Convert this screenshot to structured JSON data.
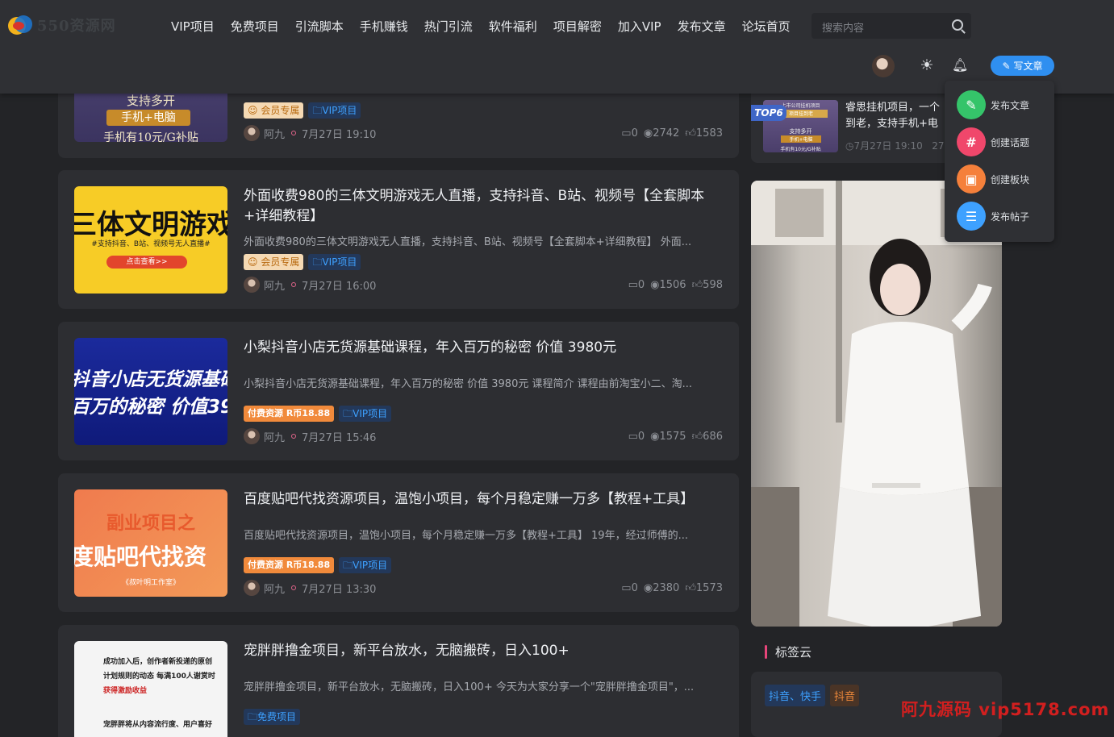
{
  "header": {
    "logo_text": "550资源网",
    "nav": [
      "VIP项目",
      "免费项目",
      "引流脚本",
      "手机赚钱",
      "热门引流",
      "软件福利",
      "项目解密",
      "加入VIP",
      "发布文章",
      "论坛首页"
    ],
    "search_placeholder": "搜索内容",
    "write_button": "写文章"
  },
  "dropdown": {
    "items": [
      {
        "label": "发布文章",
        "icon": "edit-icon",
        "color": "#35c46a"
      },
      {
        "label": "创建话题",
        "icon": "hash-icon",
        "color": "#f0476b"
      },
      {
        "label": "创建板块",
        "icon": "cube-icon",
        "color": "#f5803b"
      },
      {
        "label": "发布帖子",
        "icon": "chat-icon",
        "color": "#3ea1ff"
      }
    ]
  },
  "posts": [
    {
      "title": "",
      "excerpt": "",
      "thumb_lines": [
        "支持多开",
        "手机+电脑",
        "手机有10元/G补贴"
      ],
      "tags": [
        "会员专属",
        "VIP项目"
      ],
      "author": "阿九",
      "time": "7月27日 19:10",
      "comments": "0",
      "views": "2742",
      "likes": "1583"
    },
    {
      "title": "外面收费980的三体文明游戏无人直播，支持抖音、B站、视频号【全套脚本+详细教程】",
      "excerpt": "外面收费980的三体文明游戏无人直播，支持抖音、B站、视频号【全套脚本+详细教程】 外面...",
      "thumb_lines": [
        "三体文明游戏",
        "#支持抖音、B站、视频号无人直播#",
        "点击查看>>"
      ],
      "tags": [
        "会员专属",
        "VIP项目"
      ],
      "author": "阿九",
      "time": "7月27日 16:00",
      "comments": "0",
      "views": "1506",
      "likes": "598"
    },
    {
      "title": "小梨抖音小店无货源基础课程，年入百万的秘密 价值 3980元",
      "excerpt": "小梨抖音小店无货源基础课程，年入百万的秘密 价值 3980元 课程简介 课程由前淘宝小二、淘...",
      "thumb_lines": [
        "抖音小店无货源基础",
        "百万的秘密 价值398"
      ],
      "tags": [
        "付费资源 R币18.88",
        "VIP项目"
      ],
      "author": "阿九",
      "time": "7月27日 15:46",
      "comments": "0",
      "views": "1575",
      "likes": "686"
    },
    {
      "title": "百度贴吧代找资源项目，温饱小项目，每个月稳定赚一万多【教程+工具】",
      "excerpt": "百度贴吧代找资源项目，温饱小项目，每个月稳定赚一万多【教程+工具】 19年，经过师傅的...",
      "thumb_lines": [
        "副业项目之",
        "度贴吧代找资",
        "《叔叶明工作室》"
      ],
      "tags": [
        "付费资源 R币18.88",
        "VIP项目"
      ],
      "author": "阿九",
      "time": "7月27日 13:30",
      "comments": "0",
      "views": "2380",
      "likes": "1573"
    },
    {
      "title": "宠胖胖撸金项目，新平台放水，无脑搬砖，日入100+",
      "excerpt": "宠胖胖撸金项目，新平台放水，无脑搬砖，日入100+ 今天为大家分享一个\"宠胖胖撸金项目\"，...",
      "thumb_lines": [
        "成功加入后，创作者新投递的原创",
        "计划规则的动态 每满100人谢赏时",
        "获得激励收益",
        "宠胖胖将从内容流行度、用户喜好"
      ],
      "tags": [
        "免费项目"
      ],
      "author": "",
      "time": "",
      "comments": "",
      "views": "",
      "likes": ""
    }
  ],
  "sidebar": {
    "top6": {
      "badge": "TOP6",
      "title": "睿思挂机项目，一个",
      "title2": "到老，支持手机+电",
      "time": "7月27日 19:10",
      "views": "274",
      "thumb_lines": [
        "上市公司挂机项目",
        "项目挂到老",
        "支持多开",
        "手机+电脑",
        "手机有10元/G补贴"
      ]
    },
    "tag_cloud_title": "标签云",
    "tag_cloud": [
      {
        "label": "抖音、快手",
        "color": "#3ea1ff",
        "bg": "#23385a"
      },
      {
        "label": "抖音",
        "color": "#f08a3b",
        "bg": "#4a3426"
      }
    ]
  },
  "watermark": "阿九源码  vip5178.com"
}
